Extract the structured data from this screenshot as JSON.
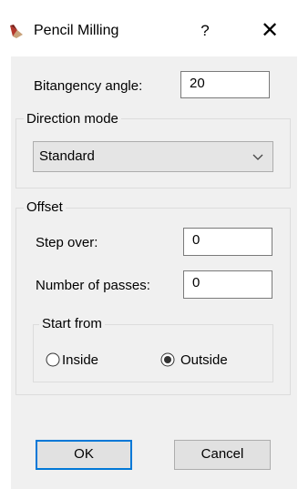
{
  "window": {
    "title": "Pencil Milling",
    "help_label": "?",
    "close_label": "✕",
    "icon": "pencil-milling-app-icon"
  },
  "bitangency": {
    "label": "Bitangency angle:",
    "value": "20"
  },
  "direction_mode": {
    "legend": "Direction mode",
    "selected": "Standard",
    "arrow_icon": "chevron-down-icon"
  },
  "offset": {
    "legend": "Offset",
    "step_over": {
      "label": "Step over:",
      "value": "0"
    },
    "passes": {
      "label": "Number of passes:",
      "value": "0"
    },
    "start_from": {
      "legend": "Start from",
      "options": [
        {
          "label": "Inside",
          "checked": false
        },
        {
          "label": "Outside",
          "checked": true
        }
      ]
    }
  },
  "buttons": {
    "ok_label": "OK",
    "cancel_label": "Cancel"
  },
  "colors": {
    "background": "#f0f0f0",
    "default_button_border": "#0078d7",
    "title_icon_red": "#b3382c",
    "title_icon_tan": "#c8a27a"
  }
}
